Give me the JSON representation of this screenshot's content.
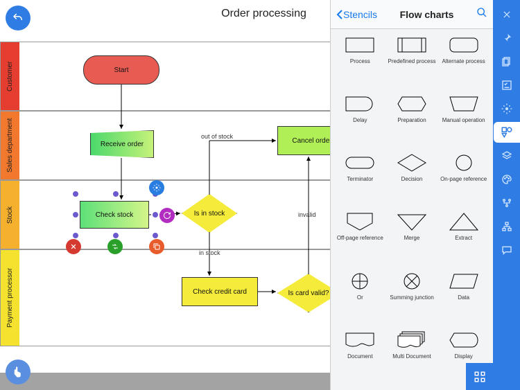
{
  "title": "Order processing",
  "lanes": {
    "customer": "Customer",
    "sales": "Sales department",
    "stock": "Stock",
    "payment": "Payment processor"
  },
  "nodes": {
    "start": "Start",
    "receive": "Receive order",
    "check_stock": "Check stock",
    "is_stock": "Is in stock",
    "cancel": "Cancel order",
    "check_credit": "Check credit card",
    "is_card": "Is card valid?"
  },
  "edge_labels": {
    "out_of_stock": "out of stock",
    "in_stock": "in stock",
    "invalid": "invalid"
  },
  "stencil": {
    "back": "Stencils",
    "title": "Flow charts",
    "items": [
      "Process",
      "Predefined process",
      "Alternate process",
      "Delay",
      "Preparation",
      "Manual operation",
      "Terminator",
      "Decision",
      "On-page reference",
      "Off-page reference",
      "Merge",
      "Extract",
      "Or",
      "Summing junction",
      "Data",
      "Document",
      "Multi Document",
      "Display"
    ]
  }
}
